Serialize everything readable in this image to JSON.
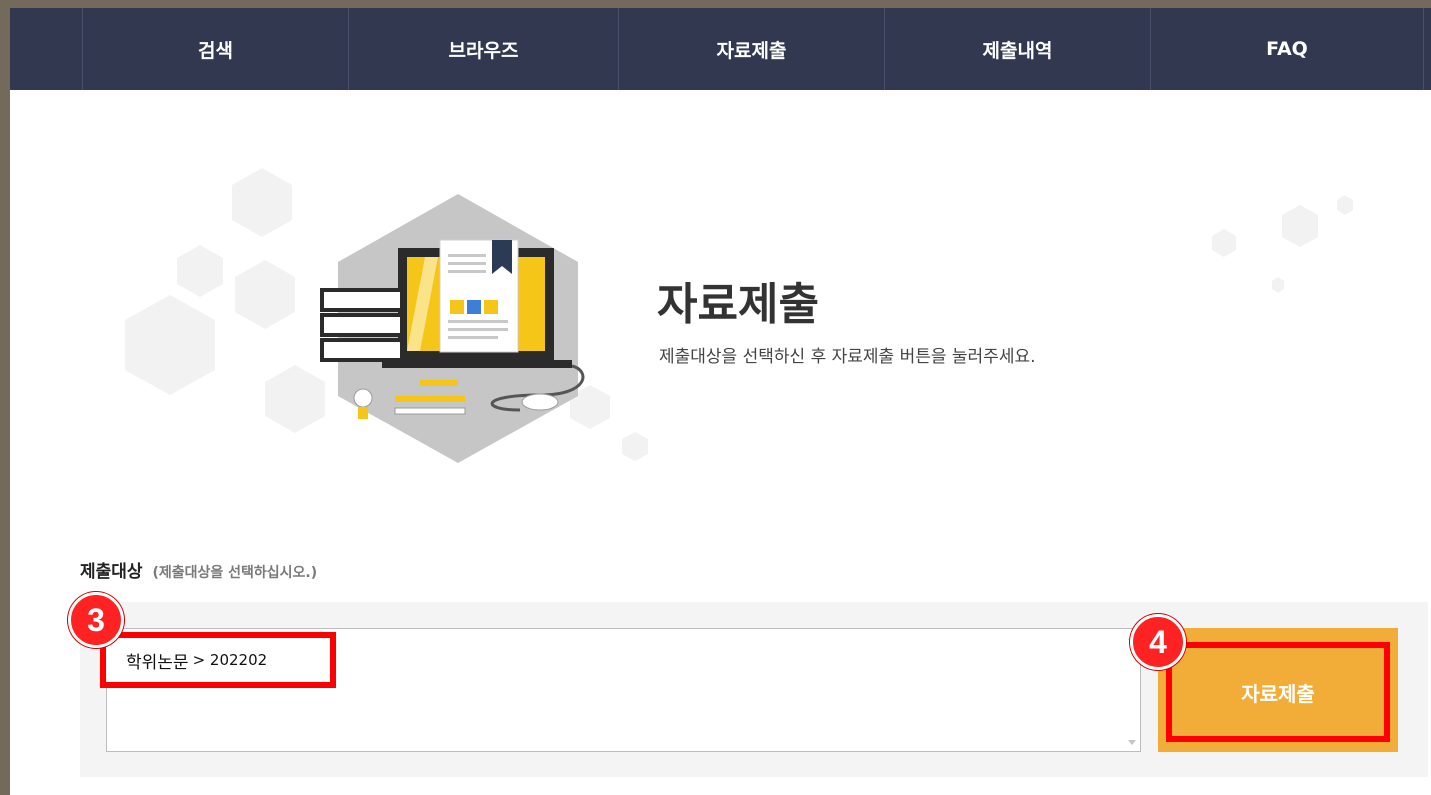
{
  "nav": {
    "items": [
      "검색",
      "브라우즈",
      "자료제출",
      "제출내역",
      "FAQ"
    ]
  },
  "hero": {
    "title": "자료제출",
    "description": "제출대상을 선택하신 후 자료제출 버튼을 눌러주세요."
  },
  "form": {
    "label": "제출대상",
    "hint": "(제출대상을 선택하십시오.)",
    "selected_option": "학위논문",
    "selected_option_suffix": "> 202202",
    "submit_label": "자료제출"
  },
  "annotations": {
    "step_3": "3",
    "step_4": "4"
  },
  "colors": {
    "nav_bg": "#32384f",
    "accent": "#f2ad38",
    "highlight": "#ff0000"
  }
}
